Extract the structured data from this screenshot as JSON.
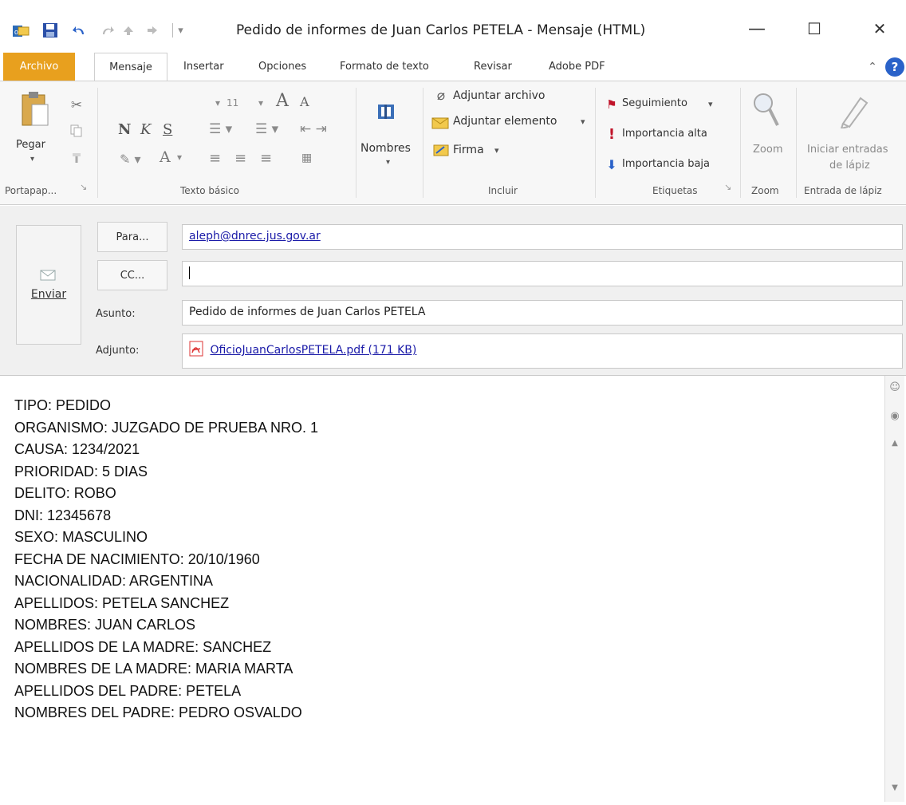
{
  "window": {
    "title": "Pedido de informes de Juan Carlos PETELA  -  Mensaje (HTML)",
    "minimize": "—",
    "maximize": "☐",
    "close": "✕"
  },
  "quick_access_icons": [
    "outlook-icon",
    "save-icon",
    "undo-icon",
    "redo-icon",
    "up-icon",
    "down-icon",
    "customize-icon"
  ],
  "tabs": [
    {
      "label": "Archivo"
    },
    {
      "label": "Mensaje"
    },
    {
      "label": "Insertar"
    },
    {
      "label": "Opciones"
    },
    {
      "label": "Formato de texto"
    },
    {
      "label": "Revisar"
    },
    {
      "label": "Adobe PDF"
    }
  ],
  "ribbon": {
    "clipboard": {
      "paste": "Pegar",
      "group": "Portapap...",
      "launcher": "↘"
    },
    "basic_text": {
      "font_size": "11",
      "bold": "N",
      "italic": "K",
      "underline": "S",
      "grow": "A",
      "shrink": "A",
      "group": "Texto básico"
    },
    "names": {
      "label": "Nombres"
    },
    "include": {
      "attach_file": "Adjuntar archivo",
      "attach_item": "Adjuntar elemento",
      "signature": "Firma",
      "group": "Incluir"
    },
    "tags": {
      "follow_up": "Seguimiento",
      "high": "Importancia alta",
      "low": "Importancia baja",
      "group": "Etiquetas"
    },
    "zoom": {
      "label": "Zoom",
      "group": "Zoom"
    },
    "ink": {
      "label_1": "Iniciar entradas",
      "label_2": "de lápiz",
      "group": "Entrada de lápiz"
    }
  },
  "compose": {
    "send": "Enviar",
    "to_button": "Para...",
    "cc_button": "CC...",
    "to_value": "aleph@dnrec.jus.gov.ar",
    "cc_value": "",
    "subject_label": "Asunto:",
    "subject_value": "Pedido de informes de Juan Carlos PETELA",
    "attach_label": "Adjunto:",
    "attachment": "OficioJuanCarlosPETELA.pdf (171 KB)"
  },
  "body_lines": [
    "TIPO: PEDIDO",
    "ORGANISMO: JUZGADO DE PRUEBA NRO. 1",
    "CAUSA: 1234/2021",
    "PRIORIDAD: 5 DIAS",
    "DELITO: ROBO",
    "DNI: 12345678",
    "SEXO: MASCULINO",
    "FECHA DE NACIMIENTO: 20/10/1960",
    "NACIONALIDAD: ARGENTINA",
    "APELLIDOS: PETELA SANCHEZ",
    "NOMBRES: JUAN CARLOS",
    "APELLIDOS DE LA MADRE: SANCHEZ",
    "NOMBRES DE LA MADRE: MARIA MARTA",
    "APELLIDOS DEL PADRE: PETELA",
    "NOMBRES DEL PADRE: PEDRO OSVALDO"
  ],
  "colors": {
    "archivo_tab": "#e8a01e",
    "link": "#1a1aa8",
    "flag": "#c0142a",
    "importance_low": "#2a62c9"
  }
}
